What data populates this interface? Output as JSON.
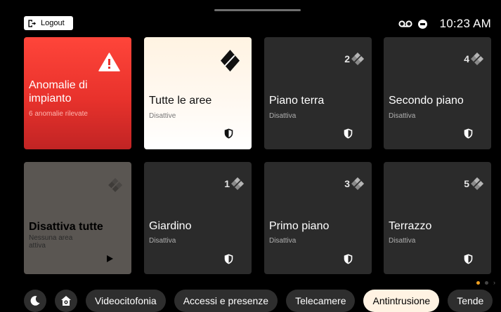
{
  "header": {
    "logout_label": "Logout",
    "time": "10:23 AM",
    "status_icons": [
      "voicemail-icon",
      "do-not-disturb-icon"
    ]
  },
  "tiles": {
    "anomalies": {
      "title": "Anomalie di impianto",
      "subtitle": "6 anomalie rilevate",
      "icon": "warning-icon"
    },
    "all_areas": {
      "title": "Tutte le aree",
      "subtitle": "Disattive",
      "icon": "alarm-diamond-icon"
    },
    "disable_all": {
      "title": "Disattiva tutte",
      "subtitle": "Nessuna area attiva",
      "icon": "play-icon"
    },
    "areas": [
      {
        "number": "2",
        "title": "Piano terra",
        "subtitle": "Disattiva"
      },
      {
        "number": "4",
        "title": "Secondo piano",
        "subtitle": "Disattiva"
      },
      {
        "number": "1",
        "title": "Giardino",
        "subtitle": "Disattiva"
      },
      {
        "number": "3",
        "title": "Primo piano",
        "subtitle": "Disattiva"
      },
      {
        "number": "5",
        "title": "Terrazzo",
        "subtitle": "Disattiva"
      }
    ]
  },
  "bottom_nav": {
    "icons": [
      "moon-icon",
      "home-gear-icon"
    ],
    "items": [
      "Videocitofonia",
      "Accessi e presenze",
      "Telecamere",
      "Antintrusione",
      "Tende"
    ],
    "active": "Antintrusione"
  },
  "colors": {
    "alarm_red": "#e8322c",
    "active_highlight": "#fff3e3",
    "page_indicator": "#f0a020",
    "tile_dark": "#2b2b2b"
  }
}
